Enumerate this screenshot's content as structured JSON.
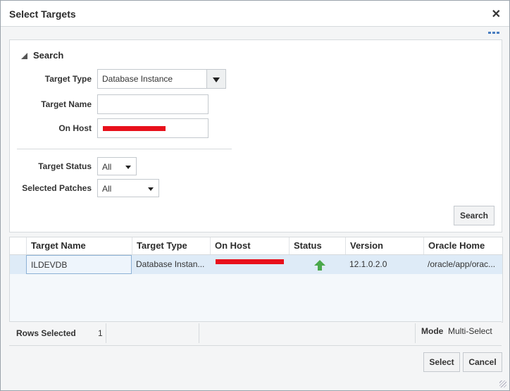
{
  "dialog": {
    "title": "Select Targets",
    "close_glyph": "✕"
  },
  "search": {
    "header": "Search",
    "target_type_label": "Target Type",
    "target_type_value": "Database Instance",
    "target_name_label": "Target Name",
    "target_name_value": "",
    "on_host_label": "On Host",
    "on_host_value": "",
    "target_status_label": "Target Status",
    "target_status_value": "All",
    "selected_patches_label": "Selected Patches",
    "selected_patches_value": "All",
    "search_button": "Search"
  },
  "table": {
    "columns": [
      "Target Name",
      "Target Type",
      "On Host",
      "Status",
      "Version",
      "Oracle Home"
    ],
    "rows": [
      {
        "target_name": "ILDEVDB",
        "target_type": "Database Instan...",
        "on_host": "",
        "status": "up",
        "version": "12.1.0.2.0",
        "oracle_home": "/oracle/app/orac..."
      }
    ]
  },
  "footer": {
    "rows_selected_label": "Rows Selected",
    "rows_selected_value": "1",
    "mode_label": "Mode",
    "mode_value": "Multi-Select"
  },
  "actions": {
    "select": "Select",
    "cancel": "Cancel"
  },
  "colors": {
    "selected_row": "#deebf7",
    "status_up": "#4aa84b",
    "redaction": "#e8101b"
  }
}
